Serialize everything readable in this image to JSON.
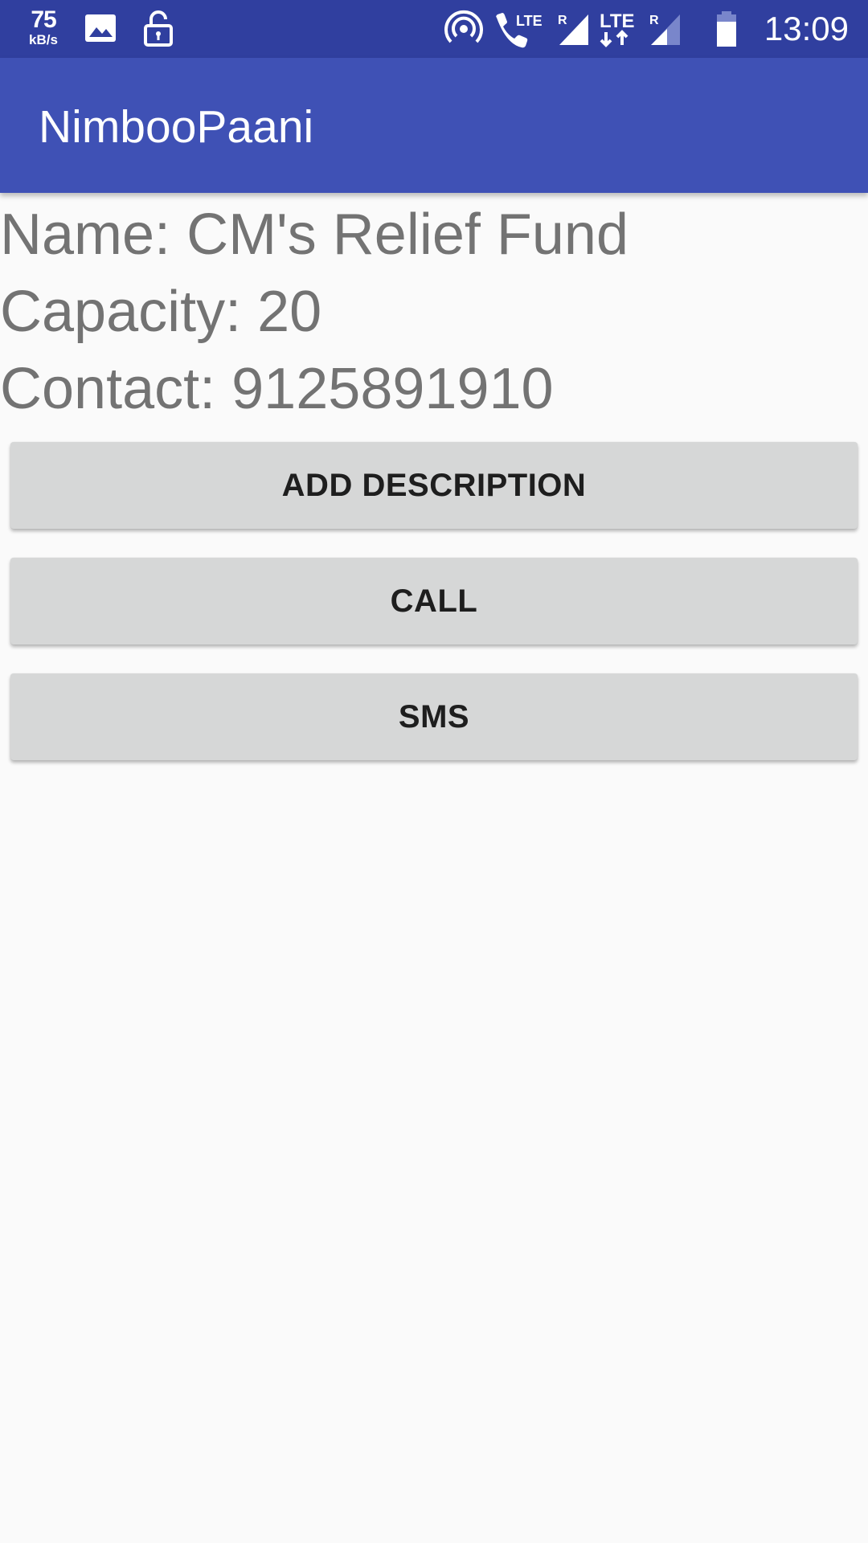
{
  "status_bar": {
    "net_speed_value": "75",
    "net_speed_unit": "kB/s",
    "icons": [
      "image-icon",
      "unlock-icon",
      "hotspot-icon",
      "volte-call-icon",
      "signal-roaming-icon",
      "lte-data-icon",
      "signal-roaming-weak-icon",
      "battery-icon"
    ],
    "lte_label_1": "LTE",
    "lte_label_2": "LTE",
    "roaming_label_1": "R",
    "roaming_label_2": "R",
    "time": "13:09"
  },
  "app_bar": {
    "title": "NimbooPaani"
  },
  "details": {
    "name": "Name: CM's Relief Fund",
    "capacity": "Capacity: 20",
    "contact": "Contact: 9125891910"
  },
  "buttons": {
    "add_description": "ADD DESCRIPTION",
    "call": "CALL",
    "sms": "SMS"
  },
  "colors": {
    "status_bar": "#303f9f",
    "app_bar": "#3f51b5",
    "background": "#fafafa",
    "detail_text": "#737373",
    "button_bg": "#d6d7d7",
    "button_text": "#1e1e1e"
  }
}
